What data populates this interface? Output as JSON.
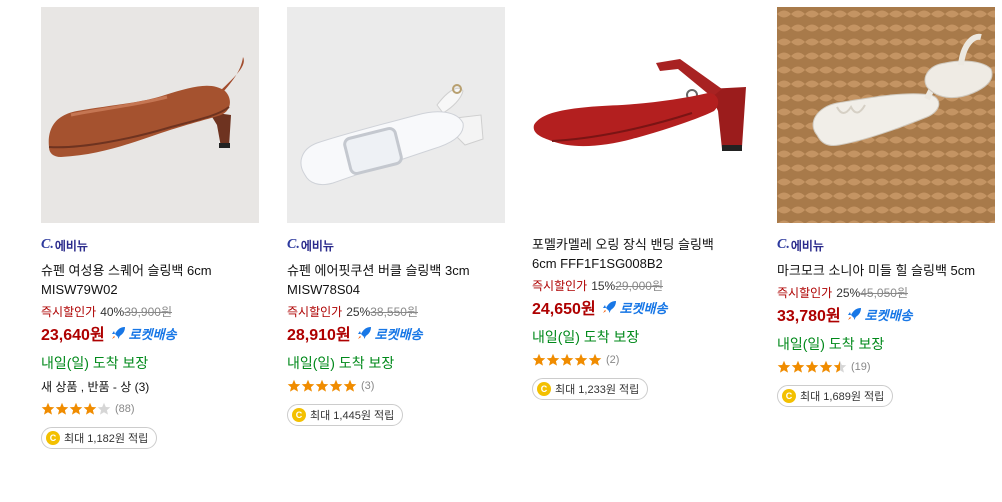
{
  "products": [
    {
      "brand": "에비뉴",
      "title": "슈펜 여성용 스퀘어 슬링백 6cm MISW79W02",
      "discount_label": "즉시할인가",
      "discount_rate": "40%",
      "original_price": "39,900원",
      "sale_price": "23,640원",
      "rocket_label": "로켓배송",
      "delivery": "내일(일) 도착 보장",
      "condition": "새 상품 , 반품 - 상 (3)",
      "rating": 4,
      "rating_count": "(88)",
      "cash_text": "최대 1,182원 적립",
      "image": "brown-square-toe-slingback-icon"
    },
    {
      "brand": "에비뉴",
      "title": "슈펜 에어핏쿠션 버클 슬링백 3cm MISW78S04",
      "discount_label": "즉시할인가",
      "discount_rate": "25%",
      "original_price": "38,550원",
      "sale_price": "28,910원",
      "rocket_label": "로켓배송",
      "delivery": "내일(일) 도착 보장",
      "rating": 5,
      "rating_count": "(3)",
      "cash_text": "최대 1,445원 적립",
      "image": "white-buckle-slingback-icon"
    },
    {
      "title": "포멜카멜레 오링 장식 밴딩 슬링백 6cm FFF1F1SG008B2",
      "discount_label": "즉시할인가",
      "discount_rate": "15%",
      "original_price": "29,000원",
      "sale_price": "24,650원",
      "rocket_label": "로켓배송",
      "delivery": "내일(일) 도착 보장",
      "rating": 5,
      "rating_count": "(2)",
      "cash_text": "최대 1,233원 적립",
      "image": "red-suede-slingback-icon"
    },
    {
      "brand": "에비뉴",
      "title": "마크모크 소니아 미들 힐 슬링백 5cm",
      "discount_label": "즉시할인가",
      "discount_rate": "25%",
      "original_price": "45,050원",
      "sale_price": "33,780원",
      "rocket_label": "로켓배송",
      "delivery": "내일(일) 도착 보장",
      "rating": 4.5,
      "rating_count": "(19)",
      "cash_text": "최대 1,689원 적립",
      "image": "ivory-ruched-slingback-icon"
    }
  ],
  "colors": {
    "price_red": "#ae0000",
    "rocket_blue": "#1877e6",
    "delivery_green": "#00891a",
    "star_orange": "#f08c00",
    "coin_yellow": "#f3c000"
  }
}
